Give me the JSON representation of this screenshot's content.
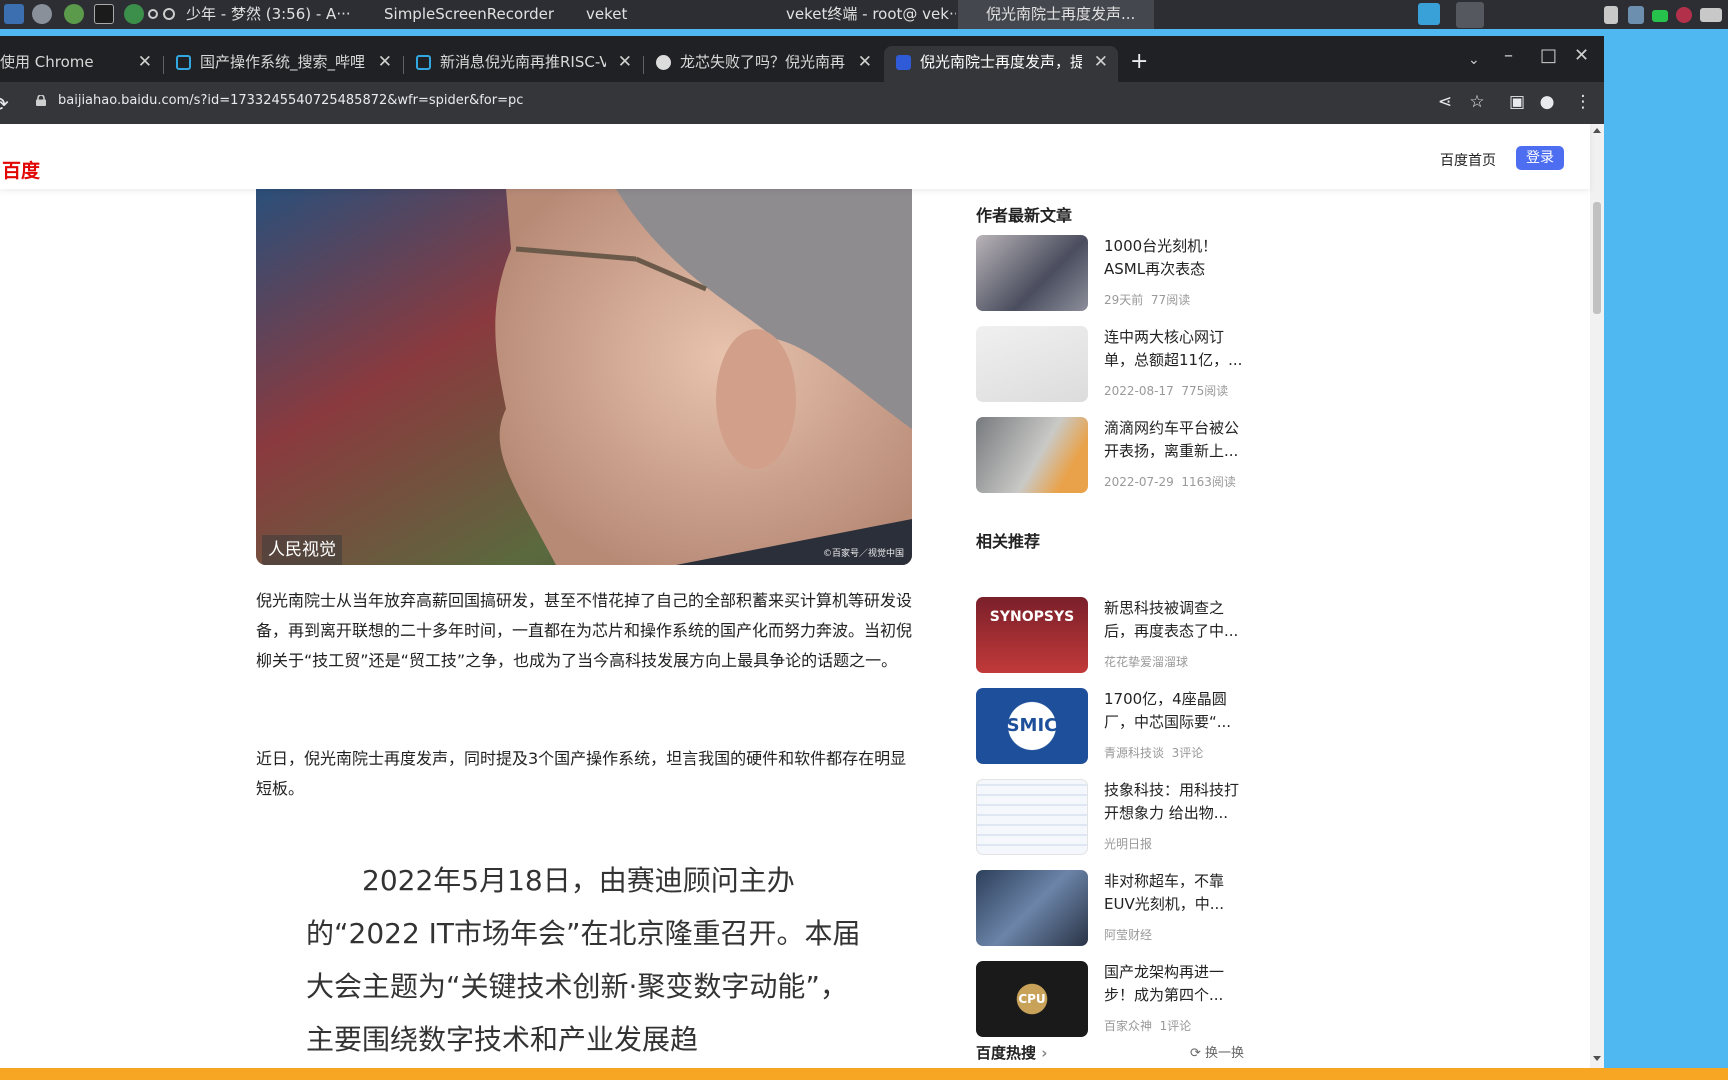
{
  "taskbar": {
    "tasks": [
      {
        "label": "少年 - 梦然 (3:56) - A···"
      },
      {
        "label": "SimpleScreenRecorder"
      },
      {
        "label": "veket"
      },
      {
        "label": "veket终端 - root@ vek···"
      },
      {
        "label": "倪光南院士再度发声..."
      }
    ]
  },
  "chrome": {
    "tabs": [
      {
        "label": "使用 Chrome",
        "close": "✕"
      },
      {
        "label": "国产操作系统_搜索_哔哩",
        "close": "✕"
      },
      {
        "label": "新消息倪光南再推RISC-V",
        "close": "✕"
      },
      {
        "label": "龙芯失败了吗？倪光南再",
        "close": "✕"
      },
      {
        "label": "倪光南院士再度发声，提",
        "close": "✕"
      }
    ],
    "new_tab": "+",
    "url": "baijiahao.baidu.com/s?id=1733245540725485872&wfr=spider&for=pc"
  },
  "baidu": {
    "logo": "百度",
    "home": "百度首页",
    "login": "登录"
  },
  "article": {
    "hero_caption": "人民视觉",
    "hero_credit": "©百家号／视觉中国",
    "paragraphs": [
      "倪光南院士从当年放弃高薪回国搞研发，甚至不惜花掉了自己的全部积蓄来买计算机等研发设备，再到离开联想的二十多年时间，一直都在为芯片和操作系统的国产化而努力奔波。当初倪柳关于“技工贸”还是“贸工技”之争，也成为了当今高科技发展方向上最具争论的话题之一。",
      "近日，倪光南院士再度发声，同时提及3个国产操作系统，坦言我国的硬件和软件都存在明显短板。"
    ],
    "quote": "2022年5月18日，由赛迪顾问主办的“2022 IT市场年会”在北京隆重召开。本届大会主题为“关键技术创新·聚变数字动能”，主要围绕数字技术和产业发展趋"
  },
  "sidebar": {
    "latest_title": "作者最新文章",
    "latest": [
      {
        "title": "1000台光刻机！ASML再次表态",
        "meta1": "29天前",
        "meta2": "77阅读"
      },
      {
        "title": "连中两大核心网订单，总额超11亿，...",
        "meta1": "2022-08-17",
        "meta2": "775阅读"
      },
      {
        "title": "滴滴网约车平台被公开表扬，离重新上...",
        "meta1": "2022-07-29",
        "meta2": "1163阅读"
      }
    ],
    "related_title": "相关推荐",
    "related": [
      {
        "title": "新思科技被调查之后，再度表态了中...",
        "meta1": "花花挚爱溜溜球",
        "meta2": "",
        "thumb_text": "SYNOPSYS"
      },
      {
        "title": "1700亿，4座晶圆厂，中芯国际要“...",
        "meta1": "青源科技谈",
        "meta2": "3评论",
        "thumb_text": "SMIC"
      },
      {
        "title": "技象科技：用科技打开想象力 给出物...",
        "meta1": "光明日报",
        "meta2": "",
        "thumb_text": ""
      },
      {
        "title": "非对称超车，不靠EUV光刻机，中...",
        "meta1": "阿莹财经",
        "meta2": "",
        "thumb_text": ""
      },
      {
        "title": "国产龙架构再进一步！成为第四个...",
        "meta1": "百家众神",
        "meta2": "1评论",
        "thumb_text": "CPU"
      }
    ],
    "hot_title": "百度热搜",
    "hot_more": "换一换"
  }
}
